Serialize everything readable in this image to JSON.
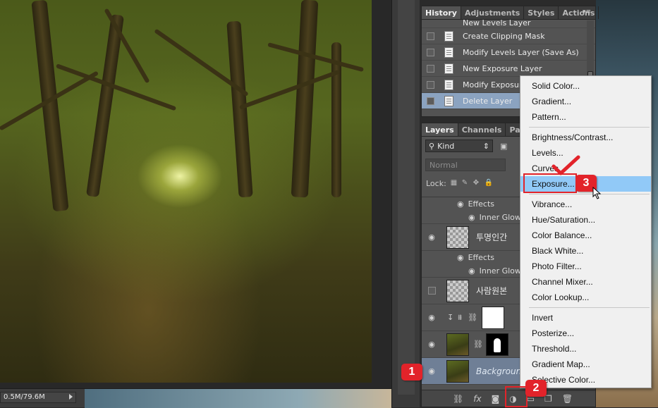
{
  "status_bar": {
    "doc_size": "0.5M/79.6M"
  },
  "history_panel": {
    "tabs": [
      "History",
      "Adjustments",
      "Styles",
      "Actions"
    ],
    "menu_glyph": "▾≡",
    "items": [
      {
        "label": "New Levels Layer",
        "selected": false
      },
      {
        "label": "Create Clipping Mask",
        "selected": false
      },
      {
        "label": "Modify Levels Layer (Save As)",
        "selected": false
      },
      {
        "label": "New Exposure Layer",
        "selected": false
      },
      {
        "label": "Modify Exposure Layer",
        "selected": false
      },
      {
        "label": "Delete Layer",
        "selected": true
      }
    ]
  },
  "layers_panel": {
    "tabs": [
      "Layers",
      "Channels",
      "Paths"
    ],
    "kind_filter": "Kind",
    "blend_mode": "Normal",
    "lock_label": "Lock:",
    "layers": [
      {
        "type": "effects",
        "label": "Effects"
      },
      {
        "type": "effect",
        "label": "Inner Glow"
      },
      {
        "type": "layer",
        "name": "투명인간",
        "visible": true
      },
      {
        "type": "effects",
        "label": "Effects"
      },
      {
        "type": "effect",
        "label": "Inner Glow"
      },
      {
        "type": "layer",
        "name": "사람원본",
        "visible": false
      },
      {
        "type": "adjustment",
        "name": "",
        "visible": true
      },
      {
        "type": "masked",
        "name": "",
        "visible": true
      },
      {
        "type": "background",
        "name": "Background",
        "visible": true
      }
    ]
  },
  "adjustment_menu": {
    "groups": [
      [
        "Solid Color...",
        "Gradient...",
        "Pattern..."
      ],
      [
        "Brightness/Contrast...",
        "Levels...",
        "Curves...",
        "Exposure..."
      ],
      [
        "Vibrance...",
        "Hue/Saturation...",
        "Color Balance...",
        "Black  White...",
        "Photo Filter...",
        "Channel Mixer...",
        "Color Lookup..."
      ],
      [
        "Invert",
        "Posterize...",
        "Threshold...",
        "Gradient Map...",
        "Selective Color..."
      ]
    ],
    "highlighted": "Exposure..."
  },
  "annotations": {
    "step1": "1",
    "step2": "2",
    "step3": "3",
    "accent": "#e2232a"
  }
}
